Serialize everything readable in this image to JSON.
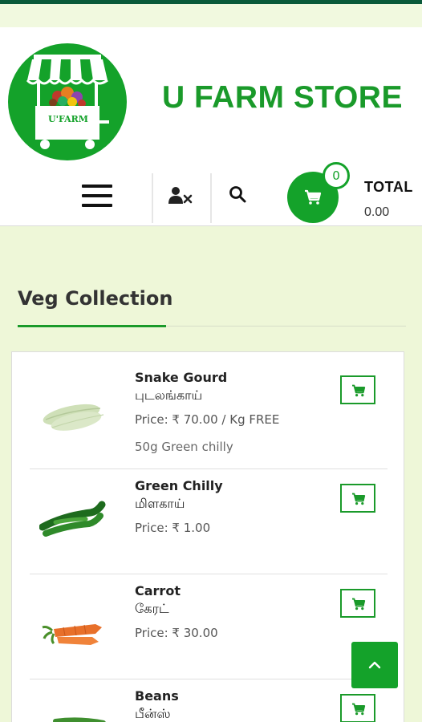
{
  "header": {
    "logo_text": "U'FARM",
    "store_name": "U FARM STORE"
  },
  "nav": {
    "cart_count": "0",
    "total_label": "TOTAL",
    "total_value": "0.00"
  },
  "section": {
    "title": "Veg Collection"
  },
  "products": [
    {
      "name": "Snake Gourd",
      "tamil": "புடலங்காய்",
      "price": "Price: ₹ 70.00 / Kg FREE",
      "note": "50g Green chilly",
      "image_icon": "snake-gourd"
    },
    {
      "name": "Green Chilly",
      "tamil": "மிளகாய்",
      "price": "Price: ₹ 1.00",
      "note": "",
      "image_icon": "green-chilly"
    },
    {
      "name": "Carrot",
      "tamil": "கேரட்",
      "price": "Price: ₹ 30.00",
      "note": "",
      "image_icon": "carrot"
    },
    {
      "name": "Beans",
      "tamil": "பீன்ஸ்",
      "price": "",
      "note": "",
      "image_icon": "beans"
    }
  ],
  "icons": {
    "menu": "hamburger-icon",
    "user": "user-times-icon",
    "search": "search-icon",
    "cart": "cart-icon",
    "add_to_cart": "cart-icon",
    "scroll_top": "chevron-up-icon"
  },
  "colors": {
    "brand_green": "#14a22a",
    "page_bg": "#eef7d8",
    "top_bar": "#0a5a3a"
  }
}
